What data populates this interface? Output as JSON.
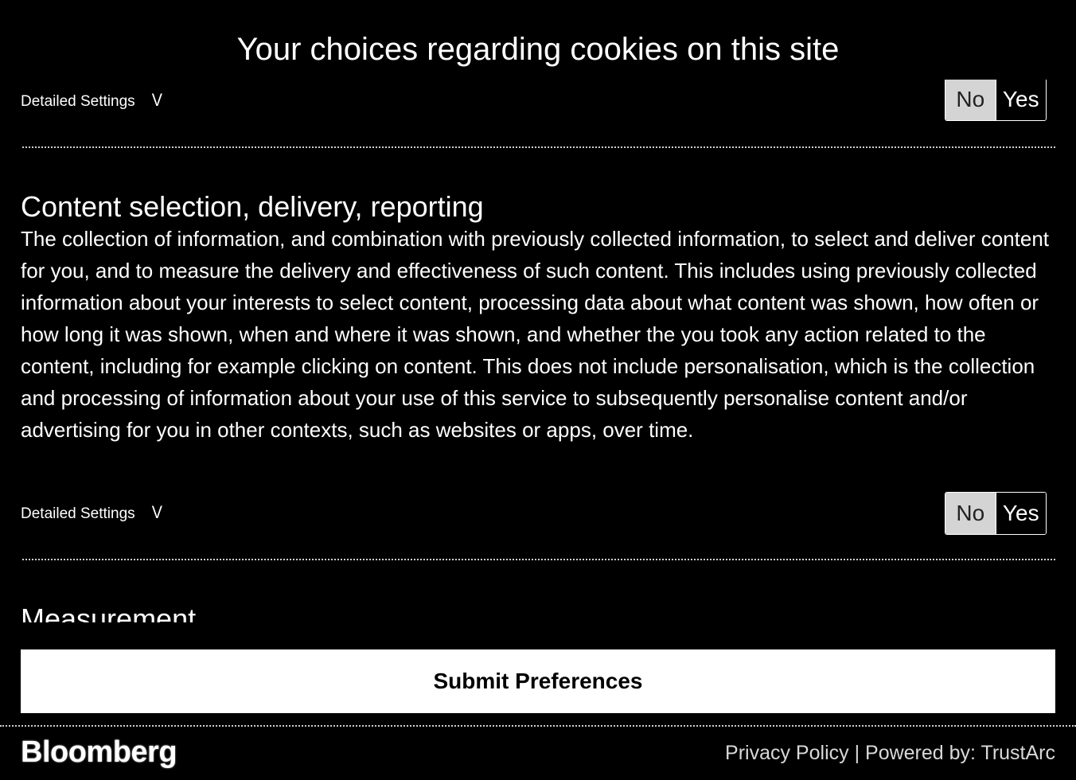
{
  "dialog": {
    "title": "Your choices regarding cookies on this site"
  },
  "sections": [
    {
      "detailed_settings_label": "Detailed Settings",
      "chevron": "V",
      "toggle": {
        "no_label": "No",
        "yes_label": "Yes",
        "selected": "No"
      }
    },
    {
      "heading": "Content selection, delivery, reporting",
      "description": "The collection of information, and combination with previously collected information, to select and deliver content for you, and to measure the delivery and effectiveness of such content. This includes using previously collected information about your interests to select content, processing data about what content was shown, how often or how long it was shown, when and where it was shown, and whether the you took any action related to the content, including for example clicking on content. This does not include personalisation, which is the collection and processing of information about your use of this service to subsequently personalise content and/or advertising for you in other contexts, such as websites or apps, over time.",
      "detailed_settings_label": "Detailed Settings",
      "chevron": "V",
      "toggle": {
        "no_label": "No",
        "yes_label": "Yes",
        "selected": "No"
      }
    },
    {
      "heading": "Measurement"
    }
  ],
  "submit_label": "Submit Preferences",
  "footer": {
    "logo": "Bloomberg",
    "privacy_policy": "Privacy Policy",
    "separator": " | ",
    "powered_by": "Powered by: TrustArc"
  },
  "colors": {
    "background": "#000000",
    "text": "#ffffff",
    "toggle_selected_bg": "#d4d4d4",
    "button_bg": "#ffffff"
  }
}
